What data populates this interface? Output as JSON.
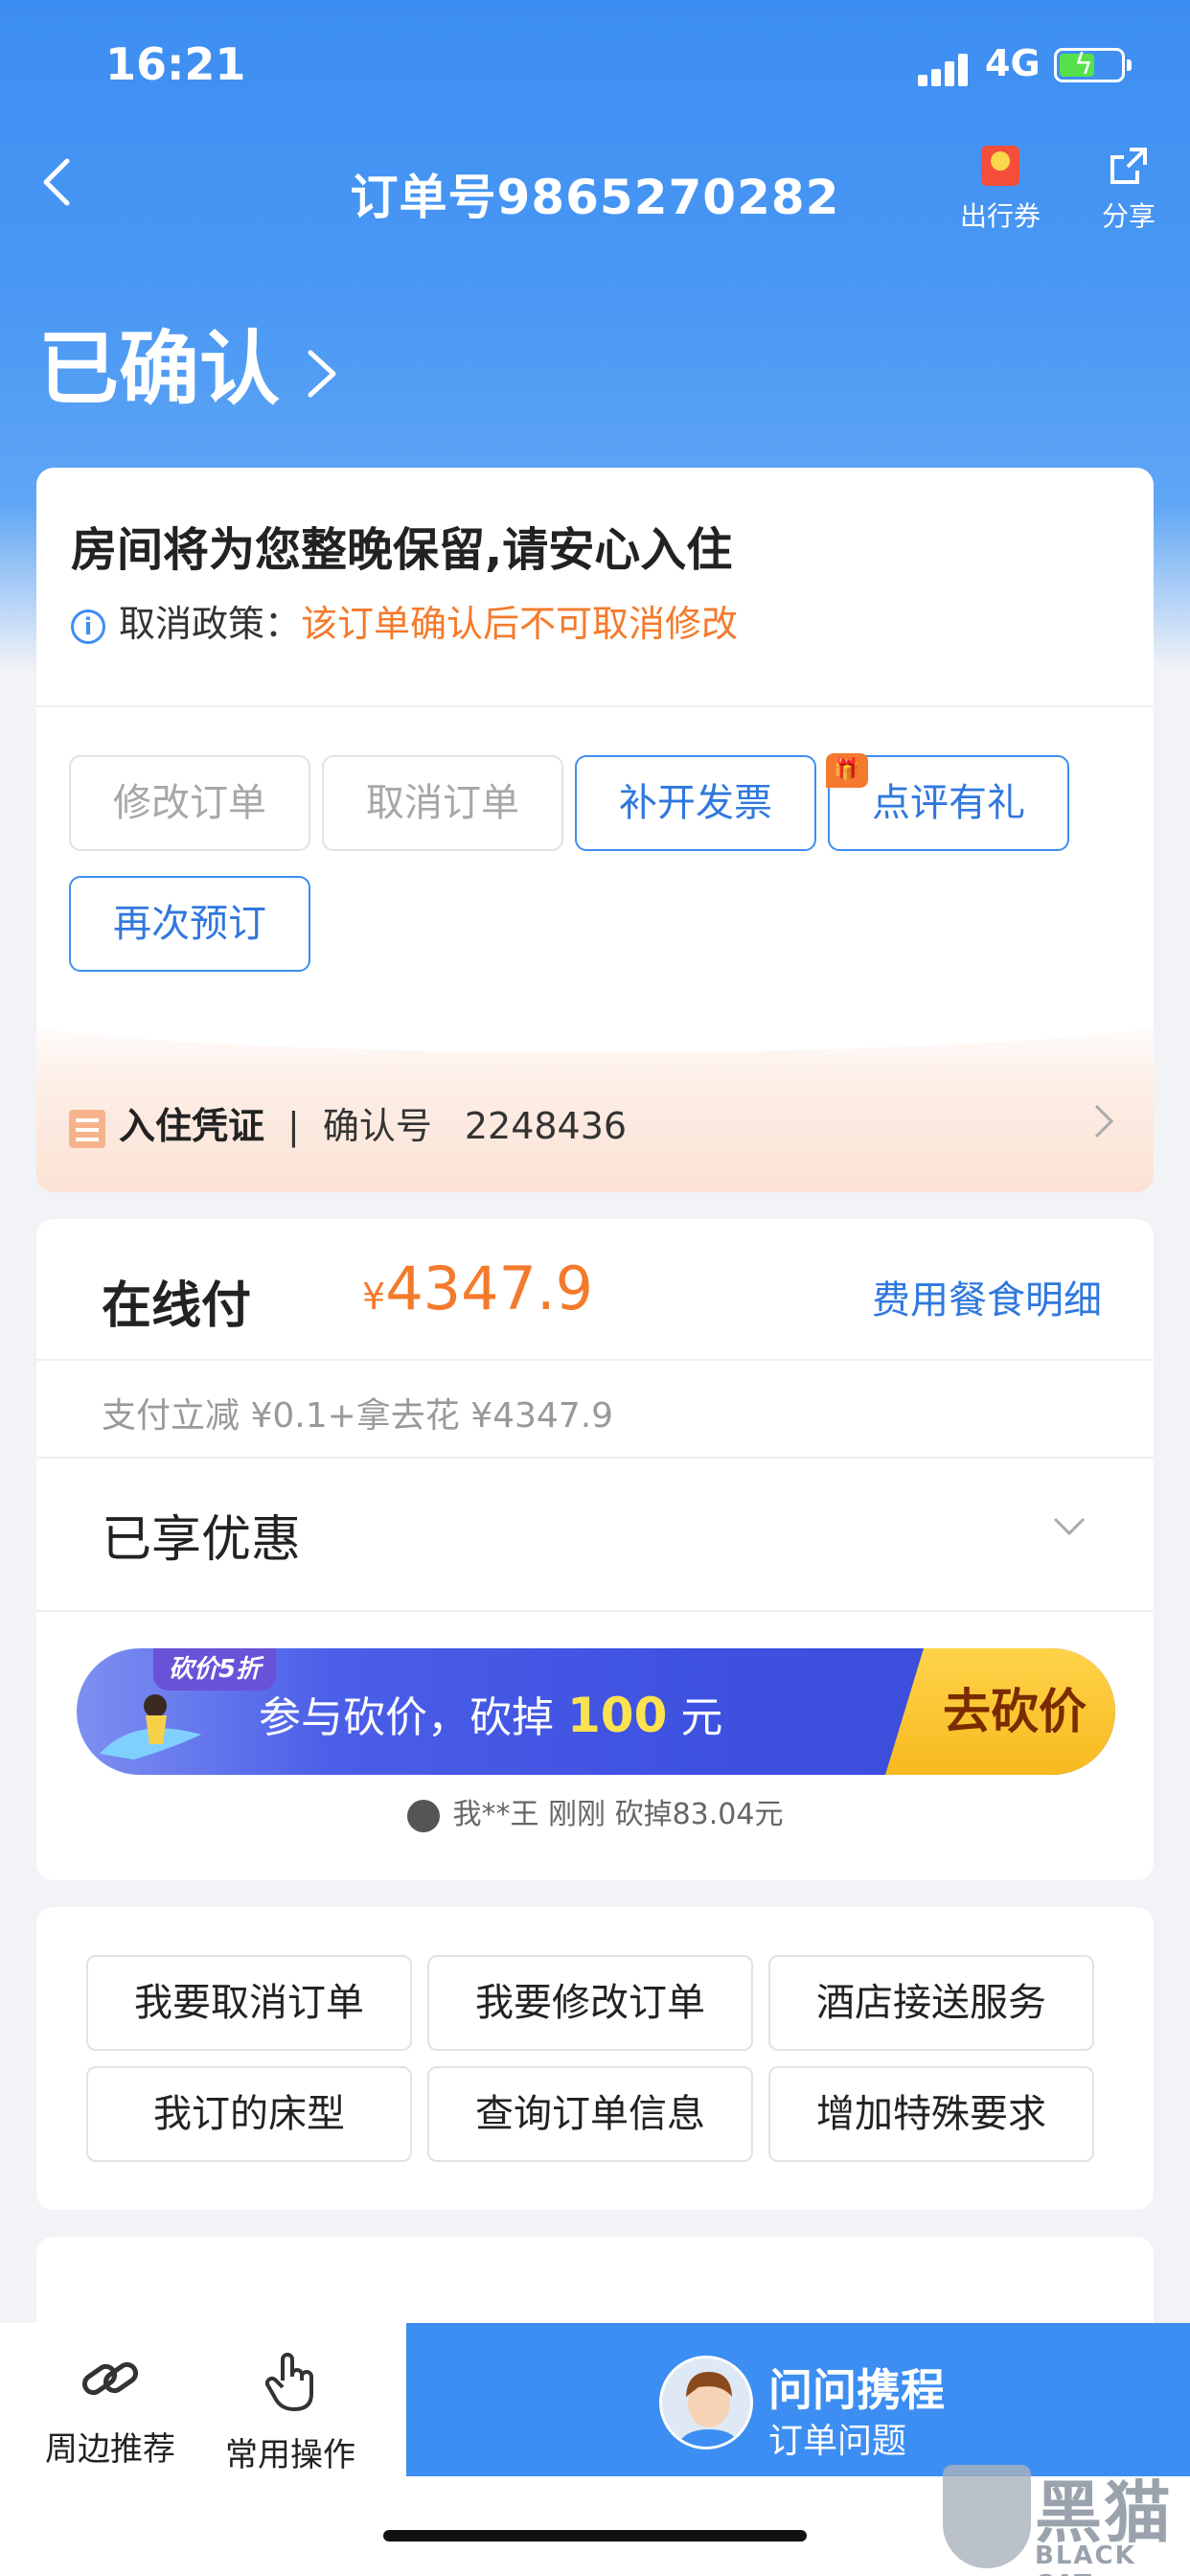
{
  "status_bar": {
    "time": "16:21",
    "network": "4G"
  },
  "navbar": {
    "title": "订单号9865270282",
    "coupon_label": "出行券",
    "share_label": "分享"
  },
  "order_status": "已确认",
  "reservation_card": {
    "headline": "房间将为您整晚保留,请安心入住",
    "policy_label": "取消政策：",
    "policy_text": "该订单确认后不可取消修改",
    "buttons": [
      {
        "label": "修改订单",
        "state": "disabled"
      },
      {
        "label": "取消订单",
        "state": "disabled"
      },
      {
        "label": "补开发票",
        "state": "active"
      },
      {
        "label": "点评有礼",
        "state": "active"
      },
      {
        "label": "再次预订",
        "state": "active"
      }
    ],
    "voucher": {
      "label": "入住凭证",
      "separator": "|",
      "confirm_label": "确认号",
      "confirm_number": "2248436"
    }
  },
  "payment_card": {
    "pay_label": "在线付",
    "currency": "¥",
    "amount": "4347.9",
    "fee_link": "费用餐食明细",
    "discount_note": "支付立减 ¥0.1+拿去花 ¥4347.9",
    "enjoyed_label": "已享优惠",
    "bargain": {
      "tag": "砍价5折",
      "text_prefix": "参与砍价，砍掉 ",
      "highlight": "100",
      "text_suffix": " 元",
      "button": "去砍价"
    },
    "bargain_feed": "我**王 刚刚 砍掉83.04元"
  },
  "quick_questions": [
    "我要取消订单",
    "我要修改订单",
    "酒店接送服务",
    "我订的床型",
    "查询订单信息",
    "增加特殊要求"
  ],
  "bottom_bar": {
    "nearby_label": "周边推荐",
    "common_label": "常用操作",
    "ask_title": "问问携程",
    "ask_sub": "订单问题"
  },
  "watermark": {
    "main": "黑猫",
    "sub": "BLACK CAT"
  },
  "colors": {
    "primary": "#3d8ef2",
    "accent_orange": "#f47a2b",
    "bargain_yellow": "#fde24f"
  }
}
